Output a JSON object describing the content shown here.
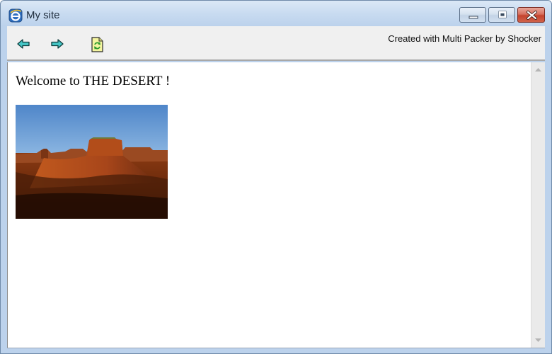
{
  "window": {
    "title": "My site",
    "controls": [
      "minimize-icon",
      "maximize-icon",
      "close-icon"
    ]
  },
  "toolbar": {
    "buttons": [
      "back-arrow-icon",
      "forward-arrow-icon",
      "refresh-page-icon"
    ],
    "credit": "Created with Multi Packer by Shocker"
  },
  "content": {
    "welcome": "Welcome to THE DESERT !",
    "image": "desert mesa photo"
  },
  "colors": {
    "titlebar": "#c7daf0",
    "toolbar": "#f0f0f0",
    "close_button": "#c4432d",
    "arrow_fill": "#45c6c6"
  }
}
